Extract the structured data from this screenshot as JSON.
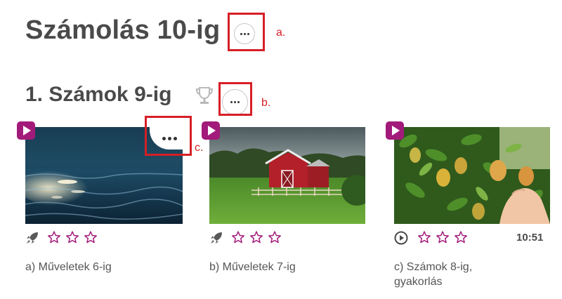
{
  "page": {
    "title": "Számolás 10-ig",
    "title_annotation": "a."
  },
  "section": {
    "title": "1. Számok 9-ig",
    "annotation": "b."
  },
  "card_annotation": "c.",
  "cards": [
    {
      "caption": "a) Műveletek 6-ig",
      "type_icon": "rocket-icon",
      "stars_filled": 0,
      "duration": ""
    },
    {
      "caption": "b) Műveletek 7-ig",
      "type_icon": "rocket-icon",
      "stars_filled": 0,
      "duration": ""
    },
    {
      "caption_line1": "c) Számok 8-ig,",
      "caption_line2": "gyakorlás",
      "type_icon": "play-circle-icon",
      "stars_filled": 0,
      "duration": "10:51"
    }
  ],
  "colors": {
    "accent": "#a31b7a",
    "annotation": "#d61f26",
    "title": "#4a4a4a"
  }
}
